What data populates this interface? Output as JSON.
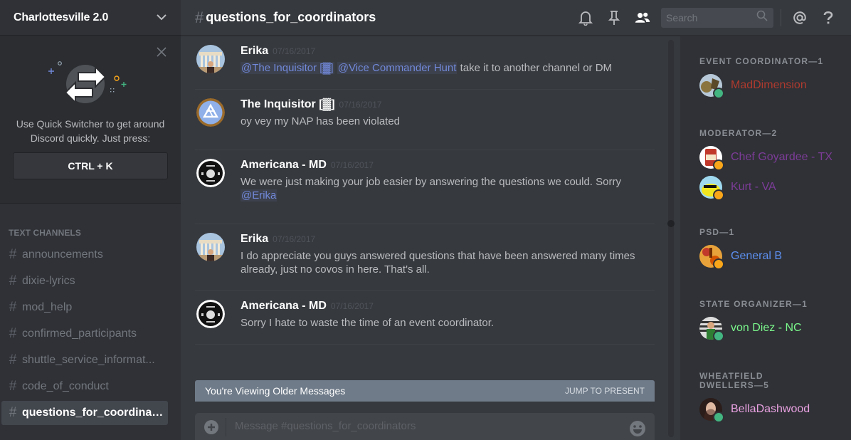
{
  "colors": {
    "online": "#43b581",
    "idle": "#faa61a",
    "mention": "#7289da",
    "banner": "#6f7b89"
  },
  "server": {
    "name": "Charlottesville 2.0",
    "dropdown_icon": "chevron-down-icon"
  },
  "quick_switcher": {
    "text": "Use Quick Switcher to get around Discord quickly. Just press:",
    "shortcut": "CTRL + K",
    "close_icon": "close-icon",
    "illustration_icon": "arrows-switch-icon"
  },
  "channels": {
    "category": "TEXT CHANNELS",
    "items": [
      {
        "name": "announcements",
        "active": false
      },
      {
        "name": "dixie-lyrics",
        "active": false
      },
      {
        "name": "mod_help",
        "active": false
      },
      {
        "name": "confirmed_participants",
        "active": false
      },
      {
        "name": "shuttle_service_informat...",
        "active": false
      },
      {
        "name": "code_of_conduct",
        "active": false
      },
      {
        "name": "questions_for_coordinat...",
        "active": true
      }
    ]
  },
  "header": {
    "hash": "#",
    "channel_title": "questions_for_coordinators",
    "icons": [
      "bell-icon",
      "pin-icon",
      "members-icon",
      "at-icon",
      "help-icon"
    ],
    "search_placeholder": "Search"
  },
  "messages": [
    {
      "author": "Erika",
      "timestamp": "07/16/2017",
      "segments": [
        {
          "type": "mention",
          "text": "@The Inquisitor [▓]"
        },
        {
          "type": "text",
          "text": " "
        },
        {
          "type": "mention",
          "text": "@Vice Commander Hunt"
        },
        {
          "type": "text",
          "text": " take it to another channel or DM"
        }
      ]
    },
    {
      "author": "The Inquisitor [▓]",
      "timestamp": "07/16/2017",
      "segments": [
        {
          "type": "text",
          "text": "oy vey my NAP has been violated"
        }
      ]
    },
    {
      "author": "Americana - MD",
      "timestamp": "07/16/2017",
      "segments": [
        {
          "type": "text",
          "text": "We were just making your job easier by answering the questions we could. Sorry "
        },
        {
          "type": "mention",
          "text": "@Erika"
        }
      ]
    },
    {
      "author": "Erika",
      "timestamp": "07/16/2017",
      "segments": [
        {
          "type": "text",
          "text": "I do appreciate you guys answered questions that have been answered many times already, just no covos in here. That's all."
        }
      ]
    },
    {
      "author": "Americana - MD",
      "timestamp": "07/16/2017",
      "segments": [
        {
          "type": "text",
          "text": "Sorry I hate to waste the time of an event coordinator."
        }
      ]
    }
  ],
  "older_banner": {
    "text": "You're Viewing Older Messages",
    "action": "JUMP TO PRESENT"
  },
  "composer": {
    "placeholder": "Message #questions_for_coordinators",
    "add_icon": "plus-circle-icon",
    "emoji_icon": "emoji-icon"
  },
  "members": {
    "groups": [
      {
        "role": "EVENT COORDINATOR—1",
        "members": [
          {
            "name": "MadDimension",
            "color": "#b03a2e",
            "status": "online"
          }
        ]
      },
      {
        "role": "MODERATOR—2",
        "members": [
          {
            "name": "Chef Goyardee - TX",
            "color": "#7d3c98",
            "status": "idle"
          },
          {
            "name": "Kurt - VA",
            "color": "#7d3c98",
            "status": "idle"
          }
        ]
      },
      {
        "role": "PSD—1",
        "members": [
          {
            "name": "General B",
            "color": "#5d8ff0",
            "status": "idle"
          }
        ]
      },
      {
        "role": "STATE ORGANIZER—1",
        "members": [
          {
            "name": "von Diez - NC",
            "color": "#7bf78b",
            "status": "online"
          }
        ]
      },
      {
        "role": "WHEATFIELD DWELLERS—5",
        "members": [
          {
            "name": "BellaDashwood",
            "color": "#e9a1e1",
            "status": "online"
          }
        ]
      }
    ]
  }
}
